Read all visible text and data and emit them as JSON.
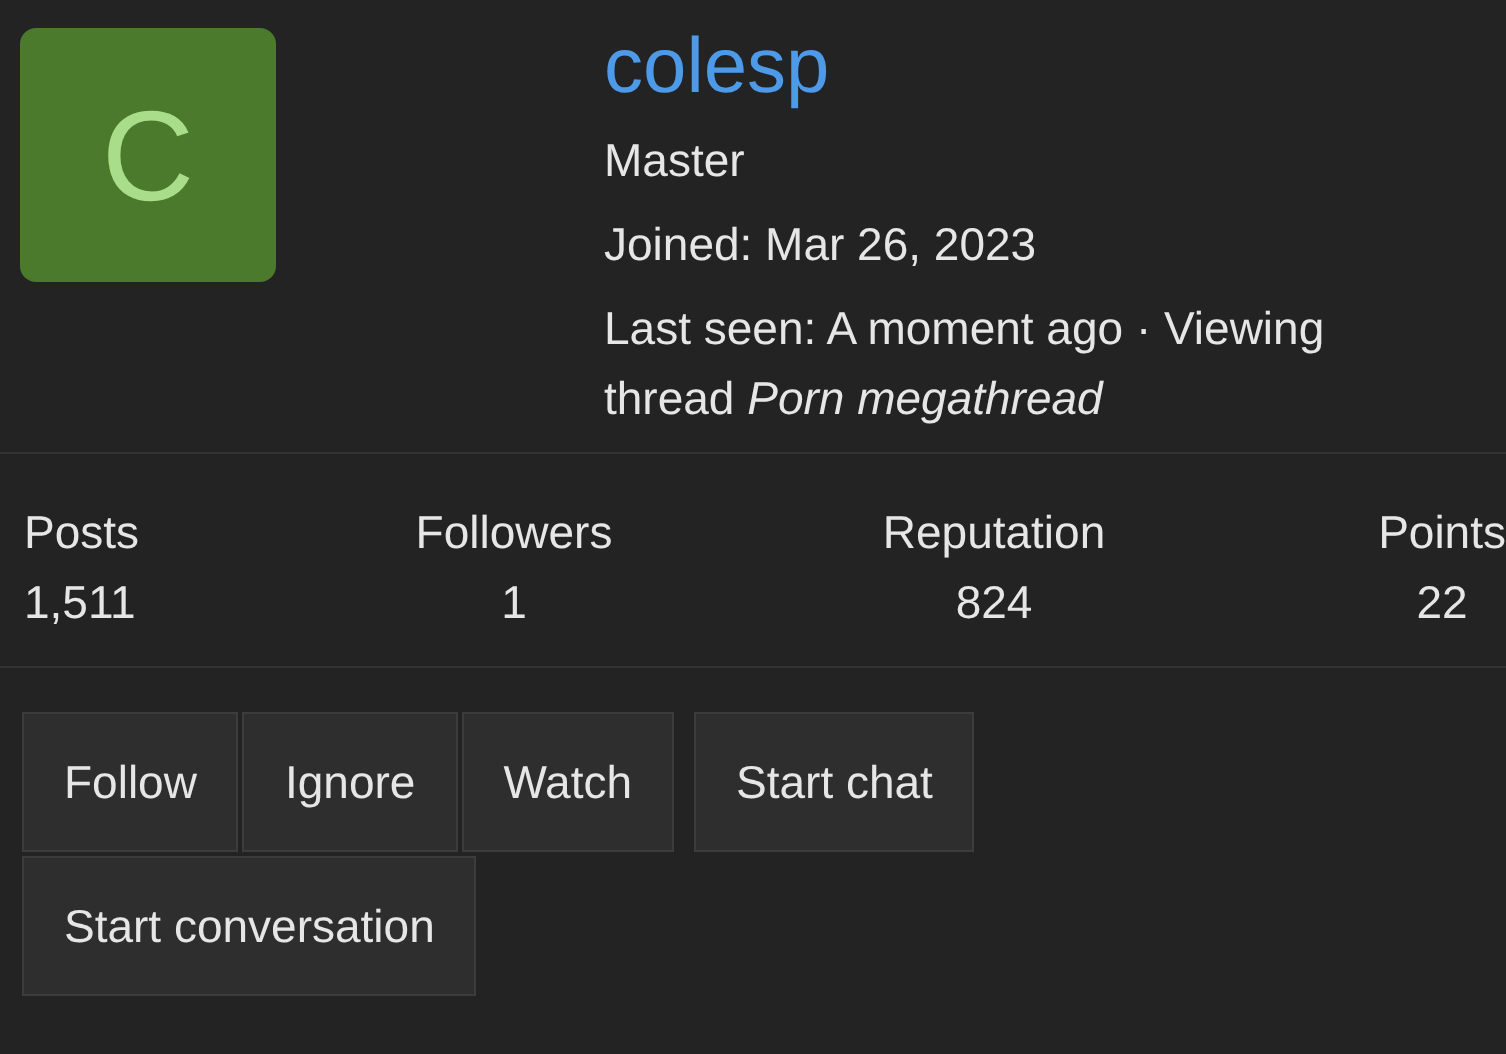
{
  "profile": {
    "avatar_letter": "C",
    "username": "colesp",
    "title": "Master",
    "joined": "Joined: Mar 26, 2023",
    "last_seen": "Last seen: A moment ago · Viewing thread *Porn megathread*"
  },
  "stats": [
    {
      "label": "Posts",
      "value": "1,511"
    },
    {
      "label": "Followers",
      "value": "1"
    },
    {
      "label": "Reputation",
      "value": "824"
    },
    {
      "label": "Points",
      "value": "22"
    }
  ],
  "button_groups": [
    [
      "Follow",
      "Ignore",
      "Watch"
    ],
    [
      "Start chat"
    ],
    [
      "Start conversation"
    ]
  ]
}
